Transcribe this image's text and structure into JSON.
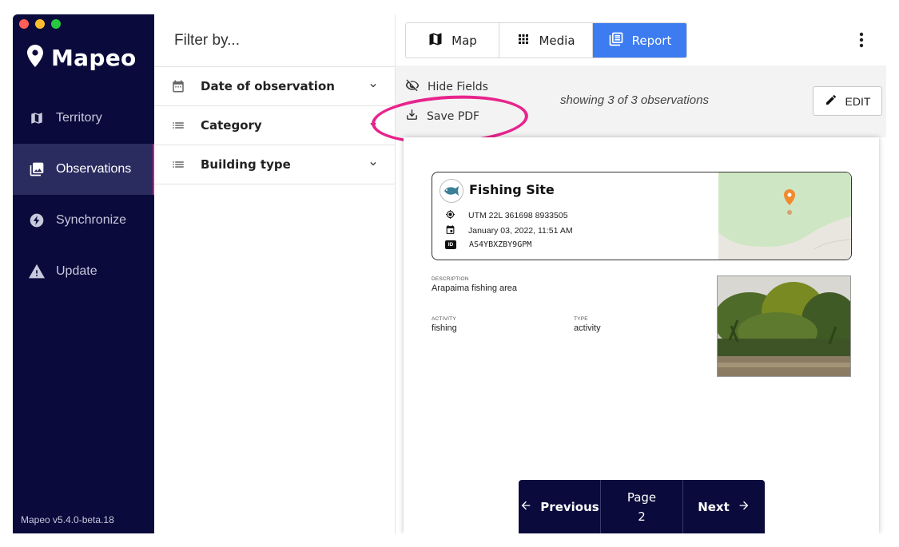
{
  "window": {
    "traffic_lights": [
      "#ff5f57",
      "#febc2e",
      "#28c840"
    ]
  },
  "sidebar": {
    "brand": "Mapeo",
    "items": [
      {
        "label": "Territory",
        "icon": "map-icon",
        "active": false
      },
      {
        "label": "Observations",
        "icon": "photo-icon",
        "active": true
      },
      {
        "label": "Synchronize",
        "icon": "bolt-icon",
        "active": false
      },
      {
        "label": "Update",
        "icon": "warning-icon",
        "active": false
      }
    ],
    "version": "Mapeo v5.4.0-beta.18"
  },
  "filter": {
    "title": "Filter by...",
    "rows": [
      {
        "label": "Date of observation",
        "icon": "calendar-icon"
      },
      {
        "label": "Category",
        "icon": "list-icon"
      },
      {
        "label": "Building type",
        "icon": "list-icon"
      }
    ]
  },
  "tabs": [
    {
      "label": "Map",
      "icon": "map-icon",
      "active": false
    },
    {
      "label": "Media",
      "icon": "grid-icon",
      "active": false
    },
    {
      "label": "Report",
      "icon": "report-icon",
      "active": true
    }
  ],
  "toolbar": {
    "hide_fields": "Hide Fields",
    "save_pdf": "Save PDF",
    "showing": "showing 3 of 3 observations",
    "edit": "EDIT"
  },
  "report": {
    "title": "Fishing Site",
    "location": "UTM 22L 361698 8933505",
    "date": "January 03, 2022, 11:51 AM",
    "id_badge": "ID",
    "id": "AS4YBXZBY9GPM",
    "description_label": "DESCRIPTION",
    "description": "Arapaima fishing area",
    "activity_label": "ACTIVITY",
    "activity": "fishing",
    "type_label": "TYPE",
    "type": "activity"
  },
  "pager": {
    "previous": "Previous",
    "page_label": "Page",
    "page_number": "2",
    "next": "Next"
  },
  "colors": {
    "sidebar_bg": "#0a0a3c",
    "accent": "#3c7cf0",
    "highlight": "#e8248c",
    "marker": "#f28a2e"
  }
}
